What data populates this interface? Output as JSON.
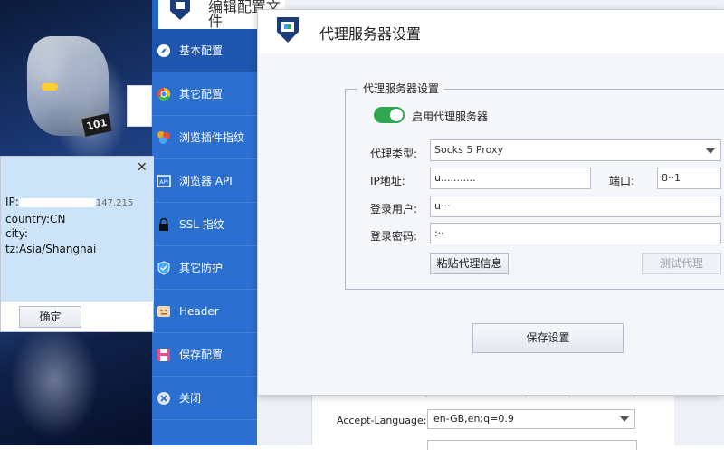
{
  "editor": {
    "title": "编辑配置文件"
  },
  "sidebar": {
    "items": [
      {
        "label": "基本配置",
        "icon": "compass-icon"
      },
      {
        "label": "其它配置",
        "icon": "chrome-icon"
      },
      {
        "label": "浏览插件指纹",
        "icon": "plugin-icon"
      },
      {
        "label": "浏览器 API",
        "icon": "api-icon"
      },
      {
        "label": "SSL 指纹",
        "icon": "lock-icon"
      },
      {
        "label": "其它防护",
        "icon": "shield-icon"
      },
      {
        "label": "Header",
        "icon": "header-icon"
      },
      {
        "label": "保存配置",
        "icon": "save-icon"
      },
      {
        "label": "关闭",
        "icon": "close-circle-icon"
      }
    ]
  },
  "proxy_dialog": {
    "title": "代理服务器设置",
    "group_title": "代理服务器设置",
    "enable_label": "启用代理服务器",
    "enabled": true,
    "type_label": "代理类型:",
    "type_value": "Socks 5 Proxy",
    "ip_label": "IP地址:",
    "ip_value": "u...........",
    "port_label": "端口:",
    "port_value": "8··1",
    "user_label": "登录用户:",
    "user_value": "u···",
    "password_label": "登录密码:",
    "password_value": ":··",
    "paste_button": "粘贴代理信息",
    "test_button": "测试代理",
    "save_button": "保存设置"
  },
  "editor_fields": {
    "accept_language_label": "Accept-Language:",
    "accept_language_value": "en-GB,en;q=0.9"
  },
  "ip_popup": {
    "ip_prefix": "IP:",
    "ip_suffix": "147.215",
    "country": "country:CN",
    "city": "city:",
    "tz": "tz:Asia/Shanghai",
    "ok_button": "确定",
    "close_glyph": "✕"
  },
  "colors": {
    "sidebar": "#2b6fd1",
    "toggle_on": "#2fa84f",
    "popup_bg": "#cde3f7"
  }
}
